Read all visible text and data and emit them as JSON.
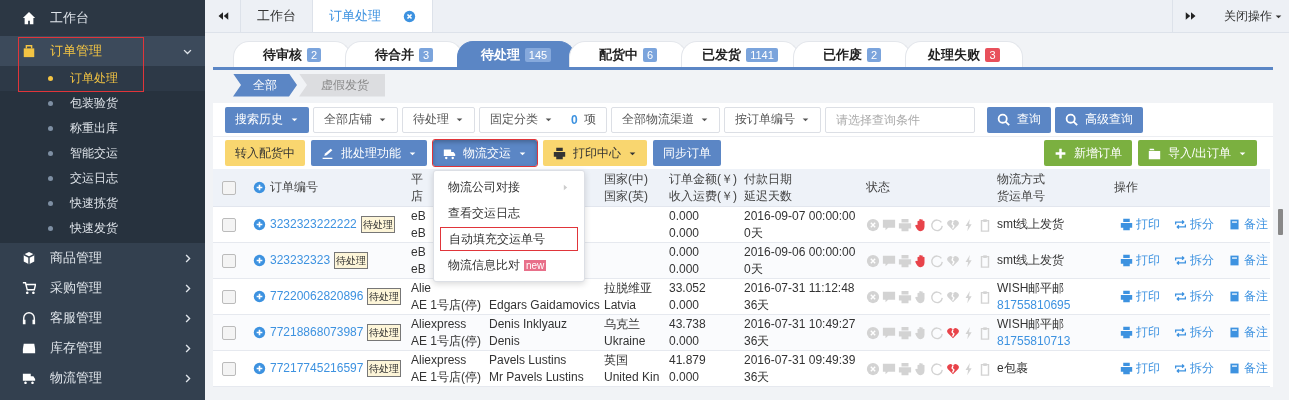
{
  "sidebar": {
    "items": [
      {
        "label": "工作台",
        "kind": "link",
        "selected": false
      },
      {
        "label": "订单管理",
        "kind": "group",
        "selected": true,
        "expanded": true,
        "highlighted": true,
        "children": [
          {
            "label": "订单处理",
            "selected": true
          },
          {
            "label": "包装验货",
            "selected": false
          },
          {
            "label": "称重出库",
            "selected": false
          },
          {
            "label": "智能交运",
            "selected": false
          },
          {
            "label": "交运日志",
            "selected": false
          },
          {
            "label": "快速拣货",
            "selected": false
          },
          {
            "label": "快速发货",
            "selected": false
          }
        ]
      },
      {
        "label": "商品管理",
        "kind": "group",
        "selected": false,
        "expanded": false
      },
      {
        "label": "采购管理",
        "kind": "group",
        "selected": false,
        "expanded": false
      },
      {
        "label": "客服管理",
        "kind": "group",
        "selected": false,
        "expanded": false
      },
      {
        "label": "库存管理",
        "kind": "group",
        "selected": false,
        "expanded": false
      },
      {
        "label": "物流管理",
        "kind": "group",
        "selected": false,
        "expanded": false
      }
    ]
  },
  "top_tabs": {
    "tabs": [
      {
        "label": "工作台",
        "selected": false,
        "closable": false
      },
      {
        "label": "订单处理",
        "selected": true,
        "closable": true
      }
    ],
    "close_menu": "关闭操作"
  },
  "status_tabs": [
    {
      "label": "待审核",
      "count": "2",
      "selected": false,
      "color": "#7ba4dc"
    },
    {
      "label": "待合并",
      "count": "3",
      "selected": false,
      "color": "#7ba4dc"
    },
    {
      "label": "待处理",
      "count": "145",
      "selected": true,
      "color": "#7ba4dc"
    },
    {
      "label": "配货中",
      "count": "6",
      "selected": false,
      "color": "#7ba4dc"
    },
    {
      "label": "已发货",
      "count": "1141",
      "selected": false,
      "color": "#7ba4dc"
    },
    {
      "label": "已作废",
      "count": "2",
      "selected": false,
      "color": "#7ba4dc"
    },
    {
      "label": "处理失败",
      "count": "3",
      "selected": false,
      "color": "#e8505b"
    }
  ],
  "sub_tabs": [
    {
      "label": "全部",
      "selected": true
    },
    {
      "label": "虚假发货",
      "selected": false
    }
  ],
  "filters": [
    {
      "kind": "button",
      "label": "搜索历史"
    },
    {
      "kind": "select",
      "label": "全部店铺"
    },
    {
      "kind": "select",
      "label": "待处理"
    },
    {
      "kind": "select",
      "label": "固定分类",
      "count": "0",
      "unit": "项"
    },
    {
      "kind": "select",
      "label": "全部物流渠道"
    },
    {
      "kind": "select",
      "label": "按订单编号"
    },
    {
      "kind": "input",
      "placeholder": "请选择查询条件"
    },
    {
      "kind": "search",
      "label": "查询"
    },
    {
      "kind": "search",
      "label": "高级查询"
    }
  ],
  "actions": [
    {
      "label": "转入配货中",
      "kind": "warning",
      "menu": false,
      "highlighted": false,
      "open": false
    },
    {
      "label": "批处理功能",
      "kind": "primary",
      "menu": true,
      "highlighted": false,
      "open": false
    },
    {
      "label": "物流交运",
      "kind": "primary",
      "menu": true,
      "highlighted": true,
      "open": true
    },
    {
      "label": "打印中心",
      "kind": "warning",
      "menu": true,
      "highlighted": false,
      "open": false
    },
    {
      "label": "同步订单",
      "kind": "primary",
      "menu": false,
      "highlighted": false,
      "open": false
    }
  ],
  "actions_right": [
    {
      "label": "新增订单",
      "menu": false
    },
    {
      "label": "导入/出订单",
      "menu": true
    }
  ],
  "logistics_menu": [
    {
      "label": "物流公司对接",
      "submenu": true,
      "highlighted": false
    },
    {
      "label": "查看交运日志",
      "submenu": false,
      "highlighted": false
    },
    {
      "label": "自动填充交运单号",
      "submenu": false,
      "highlighted": true
    },
    {
      "label": "物流信息比对",
      "submenu": false,
      "highlighted": false,
      "badge": "new"
    }
  ],
  "table": {
    "header_checked": false,
    "columns": [
      {
        "lines": [
          "订单编号"
        ]
      },
      {
        "lines": [
          "平",
          "店"
        ]
      },
      {},
      {
        "lines": [
          "国家(中)",
          "国家(英)"
        ]
      },
      {
        "lines": [
          "订单金额(￥)",
          "收入运费(￥)"
        ]
      },
      {
        "lines": [
          "付款日期",
          "延迟天数"
        ]
      },
      {
        "lines": [
          "状态"
        ]
      },
      {
        "lines": [
          "物流方式",
          "货运单号"
        ]
      },
      {
        "lines": [
          "操作"
        ]
      }
    ],
    "rows": [
      {
        "checked": false,
        "order_no": "3232323222222",
        "tag": "待处理",
        "platform": {
          "name": "eB",
          "shop": "eB"
        },
        "amount": [
          "0.000",
          "0.000"
        ],
        "paid": [
          "2016-09-07 00:00:00",
          "0天"
        ],
        "status": [
          false,
          false,
          false,
          true,
          false,
          false,
          false,
          false
        ],
        "shipping": {
          "method": "smt线上发货"
        },
        "ops": [
          "打印",
          "拆分",
          "备注"
        ]
      },
      {
        "checked": false,
        "order_no": "323232323",
        "tag": "待处理",
        "platform": {
          "name": "eB",
          "shop": "eB"
        },
        "amount": [
          "0.000",
          "0.000"
        ],
        "paid": [
          "2016-09-06 00:00:00",
          "0天"
        ],
        "status": [
          false,
          false,
          false,
          true,
          false,
          false,
          false,
          false
        ],
        "shipping": {
          "method": "smt线上发货"
        },
        "ops": [
          "打印",
          "拆分",
          "备注"
        ]
      },
      {
        "checked": false,
        "order_no": "77220062820896",
        "tag": "待处理",
        "platform": {
          "name": "Alie",
          "shop": "AE 1号店(停)"
        },
        "buyer": {
          "contact": "Edgars Gaidamovics"
        },
        "country": [
          "拉脱维亚",
          "Latvia"
        ],
        "amount": [
          "33.052",
          "0.000"
        ],
        "paid": [
          "2016-07-31 11:12:48",
          "36天"
        ],
        "status": [
          false,
          false,
          false,
          false,
          false,
          false,
          false,
          false
        ],
        "shipping": {
          "method": "WISH邮平邮",
          "tracking": "81755810695"
        },
        "ops": [
          "打印",
          "拆分",
          "备注"
        ]
      },
      {
        "checked": false,
        "order_no": "77218868073987",
        "tag": "待处理",
        "platform": {
          "name": "Aliexpress",
          "shop": "AE 1号店(停)"
        },
        "buyer": {
          "name": "Denis Inklyauz",
          "contact": "Denis"
        },
        "country": [
          "乌克兰",
          "Ukraine"
        ],
        "amount": [
          "43.738",
          "0.000"
        ],
        "paid": [
          "2016-07-31 10:49:27",
          "36天"
        ],
        "status": [
          false,
          false,
          false,
          false,
          false,
          true,
          false,
          false
        ],
        "shipping": {
          "method": "WISH邮平邮",
          "tracking": "81755810713"
        },
        "ops": [
          "打印",
          "拆分",
          "备注"
        ]
      },
      {
        "checked": false,
        "order_no": "77217745216597",
        "tag": "待处理",
        "platform": {
          "name": "Aliexpress",
          "shop": "AE 1号店(停)"
        },
        "buyer": {
          "name": "Pavels Lustins",
          "contact": "Mr Pavels Lustins"
        },
        "country": [
          "英国",
          "United Kin"
        ],
        "amount": [
          "41.879",
          "0.000"
        ],
        "paid": [
          "2016-07-31 09:49:39",
          "36天"
        ],
        "status": [
          false,
          false,
          false,
          false,
          false,
          true,
          false,
          false
        ],
        "shipping": {
          "method": "e包裹"
        },
        "ops": [
          "打印",
          "拆分",
          "备注"
        ]
      }
    ]
  }
}
